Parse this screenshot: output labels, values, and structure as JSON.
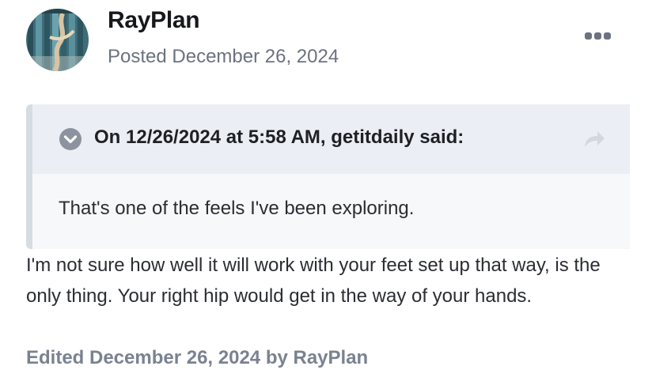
{
  "post": {
    "author": "RayPlan",
    "posted_date": "Posted December 26, 2024",
    "avatar_icon": "profile-photo",
    "more_icon": "ellipsis-icon",
    "quote": {
      "citation": "On 12/26/2024 at 5:58 AM, getitdaily said:",
      "body": "That's one of the feels I've been exploring.",
      "collapse_icon": "chevron-down-icon",
      "share_icon": "share-arrow-icon"
    },
    "body": "I'm not sure how well it will work with your feet set up that way, is the only thing. Your right hip would get in the way of your hands.",
    "edited_note": "Edited December 26, 2024 by RayPlan"
  },
  "colors": {
    "quote_header_bg": "#ebeef4",
    "quote_body_bg": "#f7f8fa",
    "quote_border": "#d7dce3",
    "muted_text": "#6b7280",
    "edited_text": "#7a8291"
  }
}
